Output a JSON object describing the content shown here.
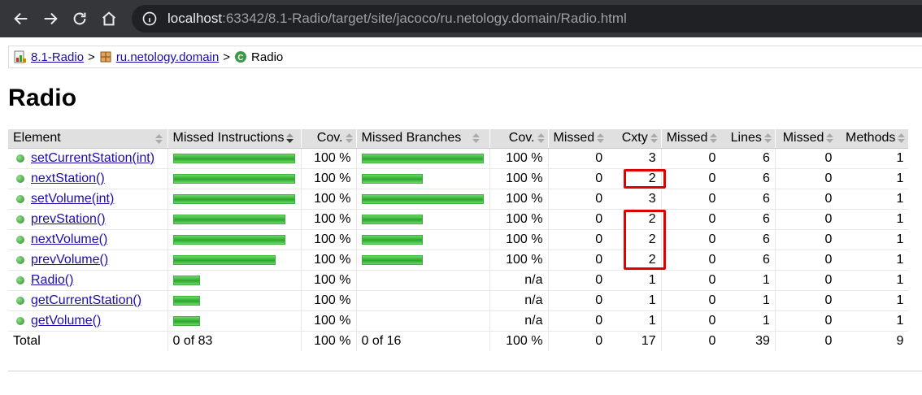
{
  "browser": {
    "url_host": "localhost",
    "url_rest": ":63342/8.1-Radio/target/site/jacoco/ru.netology.domain/Radio.html"
  },
  "breadcrumb": {
    "project": "8.1-Radio",
    "sep1": ">",
    "package": "ru.netology.domain",
    "sep2": ">",
    "class": "Radio"
  },
  "page_title": "Radio",
  "table": {
    "headers": [
      "Element",
      "Missed Instructions",
      "Cov.",
      "Missed Branches",
      "Cov.",
      "Missed",
      "Cxty",
      "Missed",
      "Lines",
      "Missed",
      "Methods"
    ],
    "rows": [
      {
        "name": "setCurrentStation(int)",
        "instr_bar": 1.0,
        "instr_cov": "100 %",
        "branch_bar": 1.0,
        "branch_cov": "100 %",
        "missed_cxty": "0",
        "cxty": "3",
        "missed_lines": "0",
        "lines": "6",
        "missed_methods": "0",
        "methods": "1",
        "highlight": false
      },
      {
        "name": "nextStation()",
        "instr_bar": 1.0,
        "instr_cov": "100 %",
        "branch_bar": 0.5,
        "branch_cov": "100 %",
        "missed_cxty": "0",
        "cxty": "2",
        "missed_lines": "0",
        "lines": "6",
        "missed_methods": "0",
        "methods": "1",
        "highlight": true
      },
      {
        "name": "setVolume(int)",
        "instr_bar": 1.0,
        "instr_cov": "100 %",
        "branch_bar": 1.0,
        "branch_cov": "100 %",
        "missed_cxty": "0",
        "cxty": "3",
        "missed_lines": "0",
        "lines": "6",
        "missed_methods": "0",
        "methods": "1",
        "highlight": false
      },
      {
        "name": "prevStation()",
        "instr_bar": 0.92,
        "instr_cov": "100 %",
        "branch_bar": 0.5,
        "branch_cov": "100 %",
        "missed_cxty": "0",
        "cxty": "2",
        "missed_lines": "0",
        "lines": "6",
        "missed_methods": "0",
        "methods": "1",
        "highlight": true
      },
      {
        "name": "nextVolume()",
        "instr_bar": 0.92,
        "instr_cov": "100 %",
        "branch_bar": 0.5,
        "branch_cov": "100 %",
        "missed_cxty": "0",
        "cxty": "2",
        "missed_lines": "0",
        "lines": "6",
        "missed_methods": "0",
        "methods": "1",
        "highlight": true
      },
      {
        "name": "prevVolume()",
        "instr_bar": 0.84,
        "instr_cov": "100 %",
        "branch_bar": 0.5,
        "branch_cov": "100 %",
        "missed_cxty": "0",
        "cxty": "2",
        "missed_lines": "0",
        "lines": "6",
        "missed_methods": "0",
        "methods": "1",
        "highlight": true
      },
      {
        "name": "Radio()",
        "instr_bar": 0.22,
        "instr_cov": "100 %",
        "branch_bar": 0,
        "branch_cov": "n/a",
        "missed_cxty": "0",
        "cxty": "1",
        "missed_lines": "0",
        "lines": "1",
        "missed_methods": "0",
        "methods": "1",
        "highlight": false
      },
      {
        "name": "getCurrentStation()",
        "instr_bar": 0.22,
        "instr_cov": "100 %",
        "branch_bar": 0,
        "branch_cov": "n/a",
        "missed_cxty": "0",
        "cxty": "1",
        "missed_lines": "0",
        "lines": "1",
        "missed_methods": "0",
        "methods": "1",
        "highlight": false
      },
      {
        "name": "getVolume()",
        "instr_bar": 0.22,
        "instr_cov": "100 %",
        "branch_bar": 0,
        "branch_cov": "n/a",
        "missed_cxty": "0",
        "cxty": "1",
        "missed_lines": "0",
        "lines": "1",
        "missed_methods": "0",
        "methods": "1",
        "highlight": false
      }
    ],
    "total": {
      "label": "Total",
      "instr": "0 of 83",
      "instr_cov": "100 %",
      "branch": "0 of 16",
      "branch_cov": "100 %",
      "missed_cxty": "0",
      "cxty": "17",
      "missed_lines": "0",
      "lines": "39",
      "missed_methods": "0",
      "methods": "9"
    }
  },
  "colors": {
    "bar_green": "#29a82a",
    "highlight_red": "#e00000",
    "link": "#1a0dab"
  }
}
